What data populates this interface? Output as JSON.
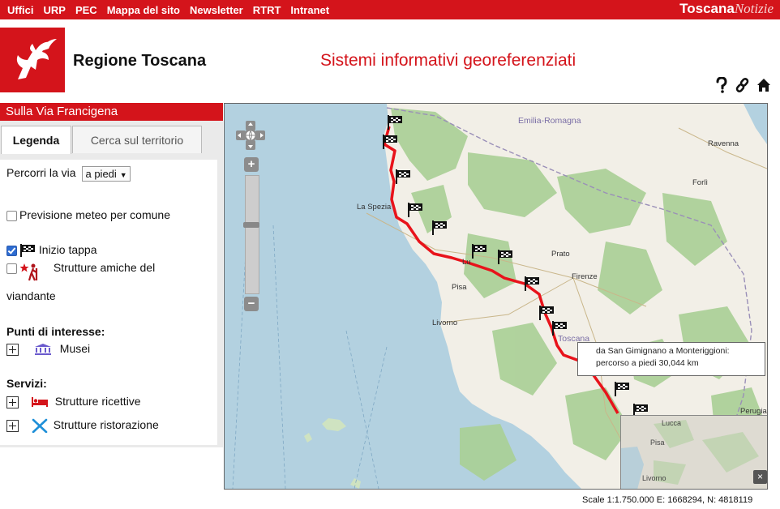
{
  "topnav": [
    "Uffici",
    "URP",
    "PEC",
    "Mappa del sito",
    "Newsletter",
    "RTRT",
    "Intranet"
  ],
  "brand": {
    "bold": "Toscana",
    "italic": "Notizie"
  },
  "header": {
    "site_title": "Regione Toscana",
    "app_title": "Sistemi informativi georeferenziati",
    "icons": [
      "help-icon",
      "link-icon",
      "home-icon"
    ]
  },
  "panel": {
    "title": "Sulla Via Francigena",
    "tabs": [
      "Legenda",
      "Cerca sul territorio"
    ],
    "percorri_label": "Percorri la via",
    "percorri_value": "a piedi",
    "meteo_label": "Previsione meteo per comune",
    "meteo_checked": false,
    "inizio_label": "Inizio tappa",
    "inizio_checked": true,
    "strutture_amiche_label_1": "Strutture amiche del",
    "strutture_amiche_label_2": "viandante",
    "strutture_amiche_checked": false,
    "punti_header": "Punti di interesse:",
    "musei_label": "Musei",
    "servizi_header": "Servizi:",
    "ricettive_label": "Strutture ricettive",
    "ristorazione_label": "Strutture ristorazione"
  },
  "map": {
    "places": {
      "emilia": "Emilia-Romagna",
      "ravenna": "Ravenna",
      "forli": "Forlì",
      "laspezia": "La Spezia",
      "prato": "Prato",
      "firenze": "Firenze",
      "pisa": "Pisa",
      "livorno": "Livorno",
      "toscana": "Toscana",
      "perugia": "Perugia",
      "lucca_frag": "Lu"
    },
    "overview_places": {
      "lucca": "Lucca",
      "pisa": "Pisa",
      "livorno": "Livorno"
    },
    "popup_line1": "da San Gimignano a Monteriggioni:",
    "popup_line2": "percorso a piedi 30,044 km",
    "route_color": "#e8131b",
    "overview_close": "×"
  },
  "footer": {
    "scale_text": "Scale 1:1.750.000 E: 1668294, N: 4818119"
  }
}
